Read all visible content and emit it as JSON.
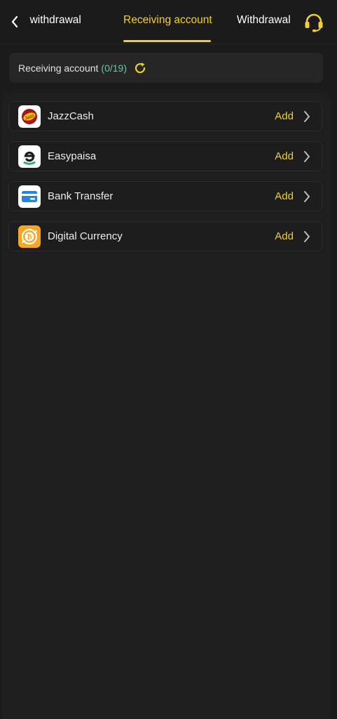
{
  "header": {
    "tabs": [
      {
        "label": "t withdrawal"
      },
      {
        "label": "Receiving account"
      },
      {
        "label": "Withdrawal"
      }
    ],
    "active_tab_color": "#f0cf2e"
  },
  "summary": {
    "label": "Receiving account",
    "count": "(0/19)"
  },
  "methods": [
    {
      "name": "JazzCash",
      "action": "Add",
      "icon": "jazzcash-logo-icon"
    },
    {
      "name": "Easypaisa",
      "action": "Add",
      "icon": "easypaisa-logo-icon"
    },
    {
      "name": "Bank Transfer",
      "action": "Add",
      "icon": "bank-card-icon"
    },
    {
      "name": "Digital Currency",
      "action": "Add",
      "icon": "digital-currency-icon"
    }
  ],
  "colors": {
    "accent": "#f0cf2e",
    "count_green": "#63c9a0",
    "background": "#1b1b1b"
  }
}
